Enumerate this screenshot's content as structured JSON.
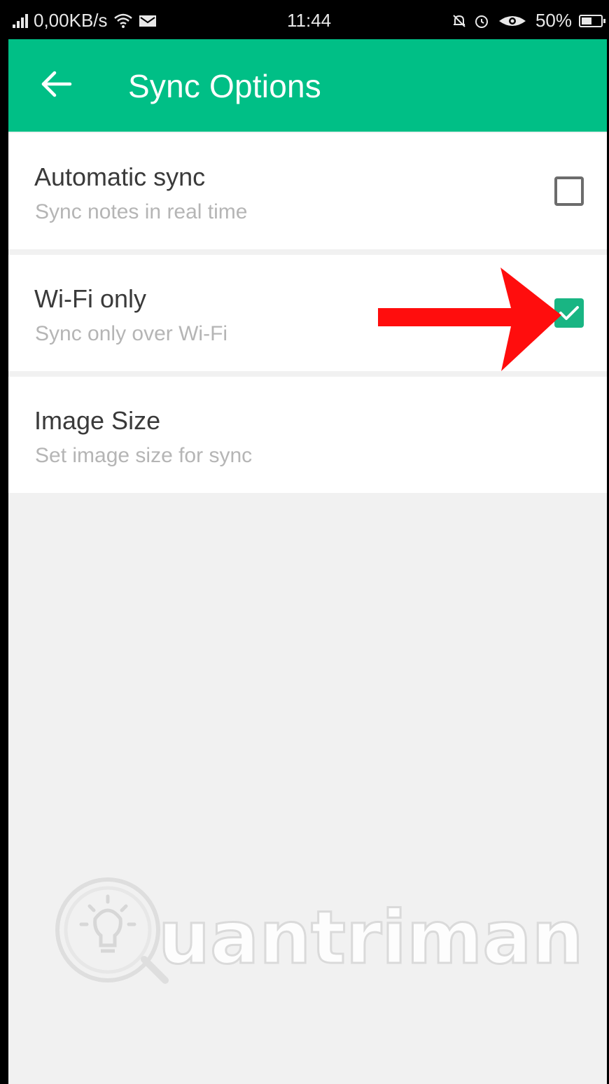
{
  "status_bar": {
    "network_speed": "0,00KB/s",
    "time": "11:44",
    "battery": "50%",
    "icons": [
      "signal-icon",
      "wifi-icon",
      "message-icon",
      "notification-icon",
      "alarm-icon",
      "eye-icon",
      "battery-icon"
    ]
  },
  "toolbar": {
    "title": "Sync Options",
    "back_icon": "back-arrow-icon",
    "color": "#00bf86"
  },
  "settings": [
    {
      "title": "Automatic sync",
      "subtitle": "Sync notes in real time",
      "checkbox": true,
      "checked": false
    },
    {
      "title": "Wi-Fi only",
      "subtitle": "Sync only over Wi-Fi",
      "checkbox": true,
      "checked": true
    },
    {
      "title": "Image Size",
      "subtitle": "Set image size for sync",
      "checkbox": false
    }
  ],
  "annotation": {
    "type": "arrow",
    "color": "#ff0d0d",
    "points_to": "wifi-only-checkbox"
  },
  "watermark": {
    "text": "Quantrimang"
  },
  "colors": {
    "accent": "#00bf86",
    "checkbox_checked": "#19b583",
    "background": "#f1f1f1"
  }
}
